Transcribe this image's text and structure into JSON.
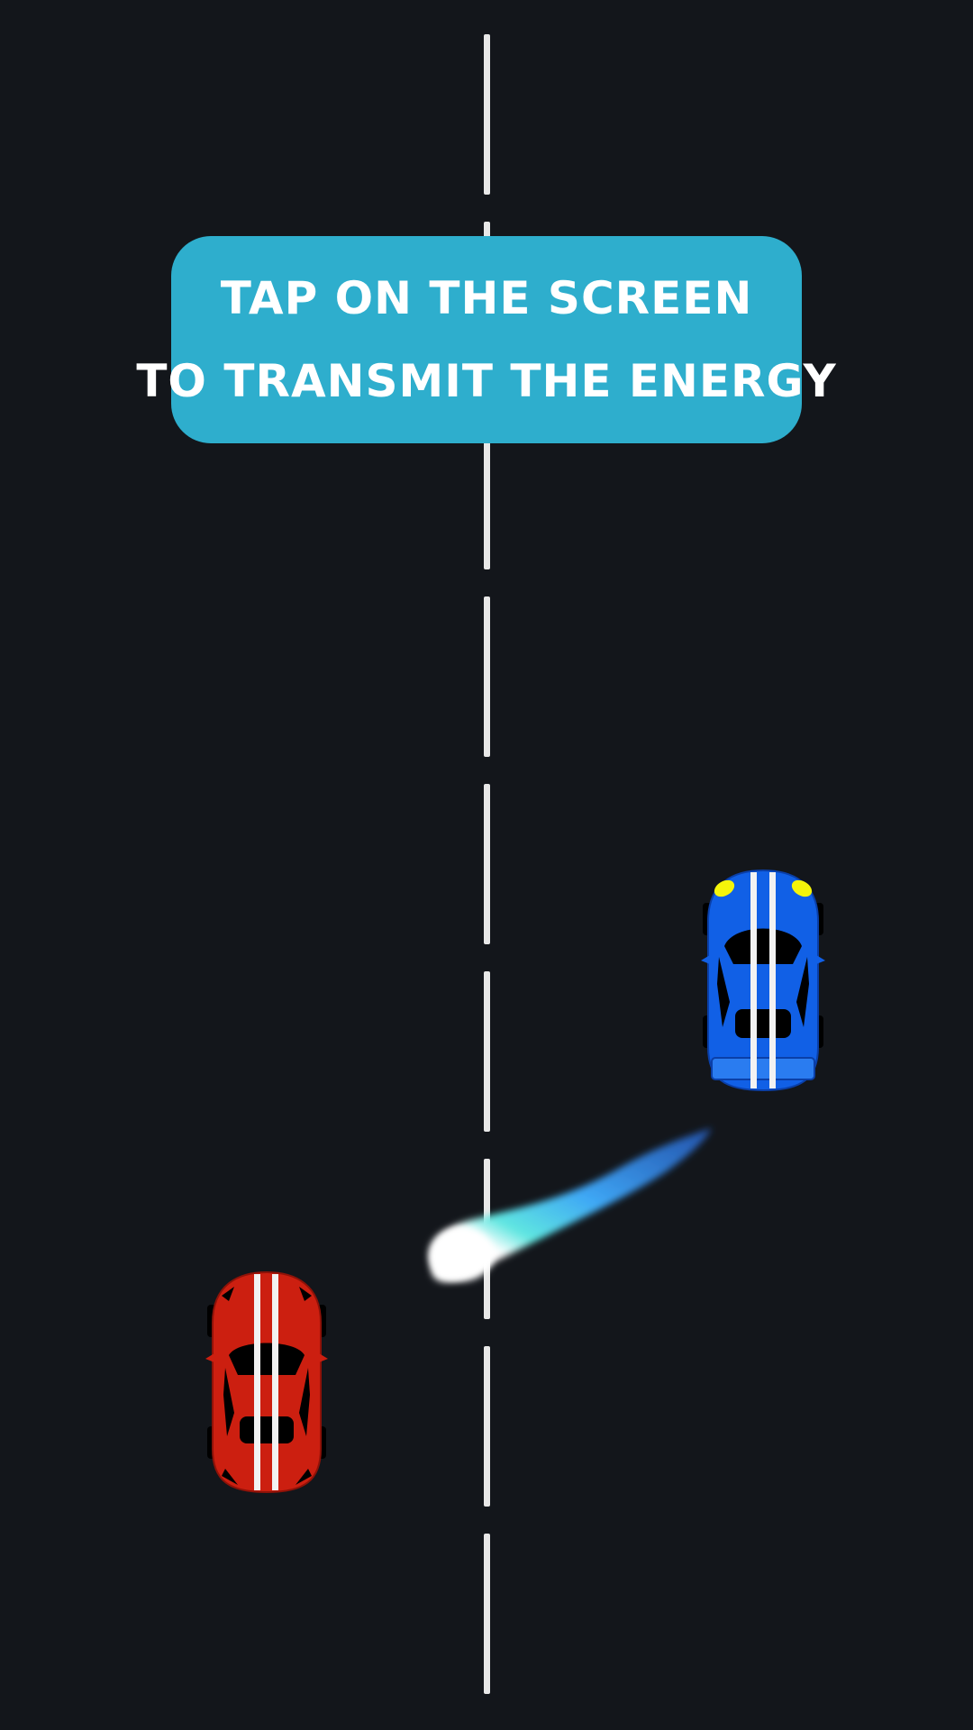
{
  "instruction": {
    "line1": "TAP ON THE SCREEN",
    "line2": "TO TRANSMIT THE ENERGY"
  },
  "colors": {
    "road": "#13161b",
    "lane_line": "#e8e8e8",
    "banner": "#2eaecd",
    "red_car": "#cc1f10",
    "blue_car": "#1160e6",
    "energy_core": "#ffffff",
    "energy_mid": "#4fe0e0",
    "energy_tail": "#2b7ef0"
  },
  "icons": {
    "player_car": "red-race-car-icon",
    "target_car": "blue-race-car-icon",
    "energy": "energy-blast-icon"
  }
}
